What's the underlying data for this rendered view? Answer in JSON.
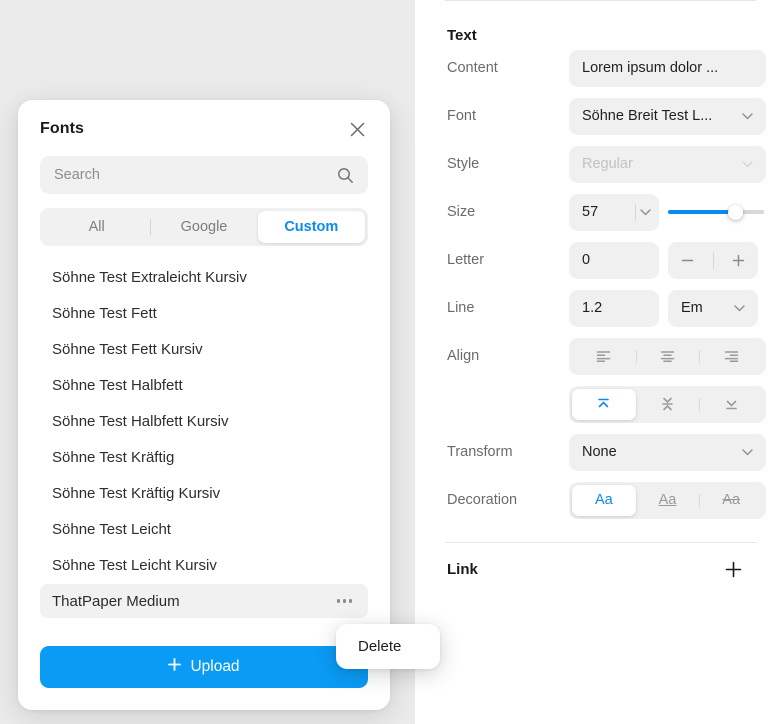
{
  "fonts_panel": {
    "title": "Fonts",
    "close_icon": "close-icon",
    "search": {
      "placeholder": "Search",
      "value": "",
      "icon": "search-icon"
    },
    "tabs": [
      {
        "label": "All",
        "active": false
      },
      {
        "label": "Google",
        "active": false
      },
      {
        "label": "Custom",
        "active": true
      }
    ],
    "font_items": [
      {
        "name": "Söhne Test Extraleicht Kursiv",
        "selected": false
      },
      {
        "name": "Söhne Test Fett",
        "selected": false
      },
      {
        "name": "Söhne Test Fett Kursiv",
        "selected": false
      },
      {
        "name": "Söhne Test Halbfett",
        "selected": false
      },
      {
        "name": "Söhne Test Halbfett Kursiv",
        "selected": false
      },
      {
        "name": "Söhne Test Kräftig",
        "selected": false
      },
      {
        "name": "Söhne Test Kräftig Kursiv",
        "selected": false
      },
      {
        "name": "Söhne Test Leicht",
        "selected": false
      },
      {
        "name": "Söhne Test Leicht Kursiv",
        "selected": false
      },
      {
        "name": "ThatPaper Medium",
        "selected": true
      }
    ],
    "upload_label": "Upload",
    "upload_icon": "plus-icon"
  },
  "context_menu": {
    "items": [
      {
        "label": "Delete"
      }
    ]
  },
  "properties": {
    "section_title": "Text",
    "content": {
      "label": "Content",
      "value": "Lorem ipsum dolor ..."
    },
    "font": {
      "label": "Font",
      "value": "Söhne Breit Test L...",
      "icon": "chevron-down-icon"
    },
    "style": {
      "label": "Style",
      "value": "Regular",
      "disabled": true,
      "icon": "chevron-down-icon"
    },
    "size": {
      "label": "Size",
      "value": "57",
      "icon": "chevron-down-icon",
      "slider_percent": 70
    },
    "letter": {
      "label": "Letter",
      "value": "0",
      "minus": "−",
      "plus": "+"
    },
    "line": {
      "label": "Line",
      "value": "1.2",
      "unit": "Em",
      "icon": "chevron-down-icon"
    },
    "align": {
      "label": "Align",
      "horizontal": [
        {
          "name": "align-left",
          "active": false
        },
        {
          "name": "align-center",
          "active": false
        },
        {
          "name": "align-right",
          "active": false
        }
      ],
      "vertical": [
        {
          "name": "align-top",
          "active": true
        },
        {
          "name": "align-middle",
          "active": false
        },
        {
          "name": "align-bottom",
          "active": false
        }
      ]
    },
    "transform": {
      "label": "Transform",
      "value": "None",
      "icon": "chevron-down-icon"
    },
    "decoration": {
      "label": "Decoration",
      "options": [
        {
          "label": "Aa",
          "style": "none",
          "active": true
        },
        {
          "label": "Aa",
          "style": "underline",
          "active": false
        },
        {
          "label": "Aa",
          "style": "strikethrough",
          "active": false
        }
      ]
    },
    "link": {
      "label": "Link",
      "add_icon": "plus-icon"
    }
  },
  "colors": {
    "accent": "#0a8bef",
    "upload_blue": "#0a9bf5",
    "canvas_bg": "#ebebeb",
    "field_bg": "#f0f0f0"
  }
}
